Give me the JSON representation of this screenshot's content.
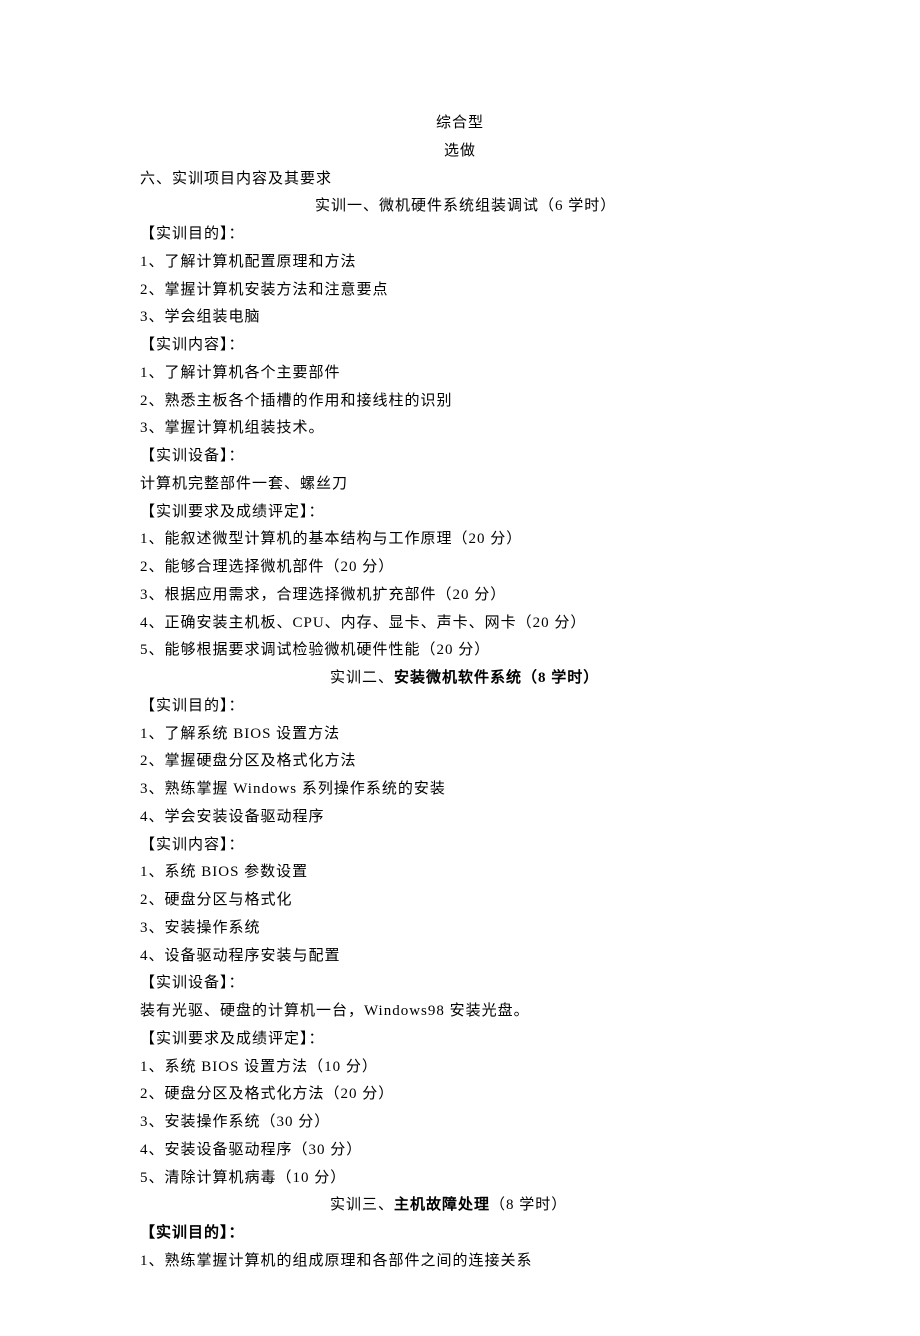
{
  "header": {
    "line1": "综合型",
    "line2": "选做"
  },
  "section_title": "六、实训项目内容及其要求",
  "trainings": [
    {
      "heading_prefix": "实训一、微机硬件系统组装调试（6 学时）",
      "heading_bold": "",
      "heading_suffix": "",
      "groups": [
        {
          "label": "【实训目的】：",
          "items": [
            "1、了解计算机配置原理和方法",
            "2、掌握计算机安装方法和注意要点",
            "3、学会组装电脑"
          ]
        },
        {
          "label": "【实训内容】：",
          "items": [
            "1、了解计算机各个主要部件",
            "2、熟悉主板各个插槽的作用和接线柱的识别",
            "3、掌握计算机组装技术。"
          ]
        },
        {
          "label": "【实训设备】：",
          "items": [
            "计算机完整部件一套、螺丝刀"
          ]
        },
        {
          "label": "【实训要求及成绩评定】：",
          "items": [
            "1、能叙述微型计算机的基本结构与工作原理（20 分）",
            "2、能够合理选择微机部件（20 分）",
            "3、根据应用需求，合理选择微机扩充部件（20 分）",
            "4、正确安装主机板、CPU、内存、显卡、声卡、网卡（20 分）",
            "5、能够根据要求调试检验微机硬件性能（20 分）"
          ]
        }
      ]
    },
    {
      "heading_prefix": "实训二、",
      "heading_bold": "安装微机软件系统（8 学时）",
      "heading_suffix": "",
      "groups": [
        {
          "label": "【实训目的】：",
          "items": [
            "1、了解系统 BIOS 设置方法",
            "2、掌握硬盘分区及格式化方法",
            "3、熟练掌握 Windows 系列操作系统的安装",
            "4、学会安装设备驱动程序"
          ]
        },
        {
          "label": "【实训内容】：",
          "items": [
            "1、系统 BIOS 参数设置",
            "2、硬盘分区与格式化",
            "3、安装操作系统",
            "4、设备驱动程序安装与配置"
          ]
        },
        {
          "label": "【实训设备】：",
          "items": [
            "装有光驱、硬盘的计算机一台，Windows98 安装光盘。"
          ]
        },
        {
          "label": "【实训要求及成绩评定】：",
          "items": [
            "1、系统 BIOS 设置方法（10 分）",
            "2、硬盘分区及格式化方法（20 分）",
            "3、安装操作系统（30 分）",
            "4、安装设备驱动程序（30 分）",
            "5、清除计算机病毒（10 分）"
          ]
        }
      ]
    },
    {
      "heading_prefix": "实训三、",
      "heading_bold": "主机故障处理",
      "heading_suffix": "（8 学时）",
      "groups": [
        {
          "label": "【实训目的】：",
          "items": [
            "1、熟练掌握计算机的组成原理和各部件之间的连接关系"
          ]
        }
      ]
    }
  ]
}
